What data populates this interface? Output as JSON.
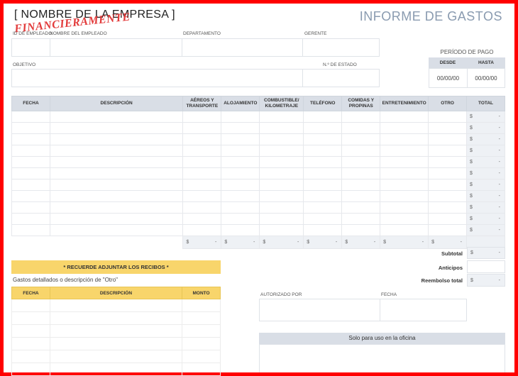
{
  "header": {
    "company": "[ NOMBRE DE LA EMPRESA ]",
    "title": "INFORME DE GASTOS",
    "watermark": "FINANCIERAMENTE"
  },
  "fields": {
    "emp_id_label": "ID DE EMPLEADO",
    "emp_name_label": "NOMBRE DEL EMPLEADO",
    "department_label": "DEPARTAMENTO",
    "manager_label": "GERENTE",
    "objective_label": "OBJETIVO",
    "statement_label": "N.º DE ESTADO"
  },
  "period": {
    "title": "PERÍODO DE PAGO",
    "from_label": "DESDE",
    "to_label": "HASTA",
    "from_value": "00/00/00",
    "to_value": "00/00/00"
  },
  "expense_table": {
    "columns": [
      "FECHA",
      "DESCRIPCIÓN",
      "AÉREOS Y TRANSPORTE",
      "ALOJAMIENTO",
      "COMBUSTIBLE/ KILOMETRAJE",
      "TELÉFONO",
      "COMIDAS Y PROPINAS",
      "ENTRETENIMIENTO",
      "OTRO",
      "TOTAL"
    ],
    "currency": "$",
    "dash": "-"
  },
  "summary": {
    "subtotal_label": "Subtotal",
    "advances_label": "Anticipos",
    "reimbursement_label": "Reembolso total"
  },
  "receipts": {
    "banner": "* RECUERDE ADJUNTAR LOS RECIBOS *",
    "detail_text": "Gastos detallados o descripción de \"Otro\"",
    "columns": [
      "FECHA",
      "DESCRIPCIÓN",
      "MONTO"
    ]
  },
  "approval": {
    "authorized_label": "AUTORIZADO POR",
    "date_label": "FECHA"
  },
  "office": {
    "label": "Solo para uso en la oficina"
  },
  "colors": {
    "border": "#ff0000",
    "header_gray": "#d9dee6",
    "yellow": "#f8d56b",
    "title_blue": "#8a9bb0"
  }
}
